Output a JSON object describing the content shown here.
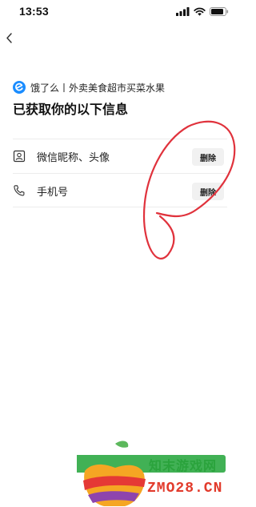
{
  "status_bar": {
    "time": "13:53"
  },
  "header": {
    "app_name": "饿了么丨外卖美食超市买菜水果",
    "title": "已获取你的以下信息"
  },
  "info_items": [
    {
      "label": "微信昵称、头像",
      "icon": "profile-card-icon",
      "action_label": "删除"
    },
    {
      "label": "手机号",
      "icon": "phone-icon",
      "action_label": "删除"
    }
  ],
  "watermark": {
    "text_cn": "知末游戏网",
    "text_en": "ZMO28.CN"
  },
  "colors": {
    "annotation": "#e0323c",
    "app_logo": "#1a8cff",
    "delete_bg": "#f1f1f1"
  }
}
